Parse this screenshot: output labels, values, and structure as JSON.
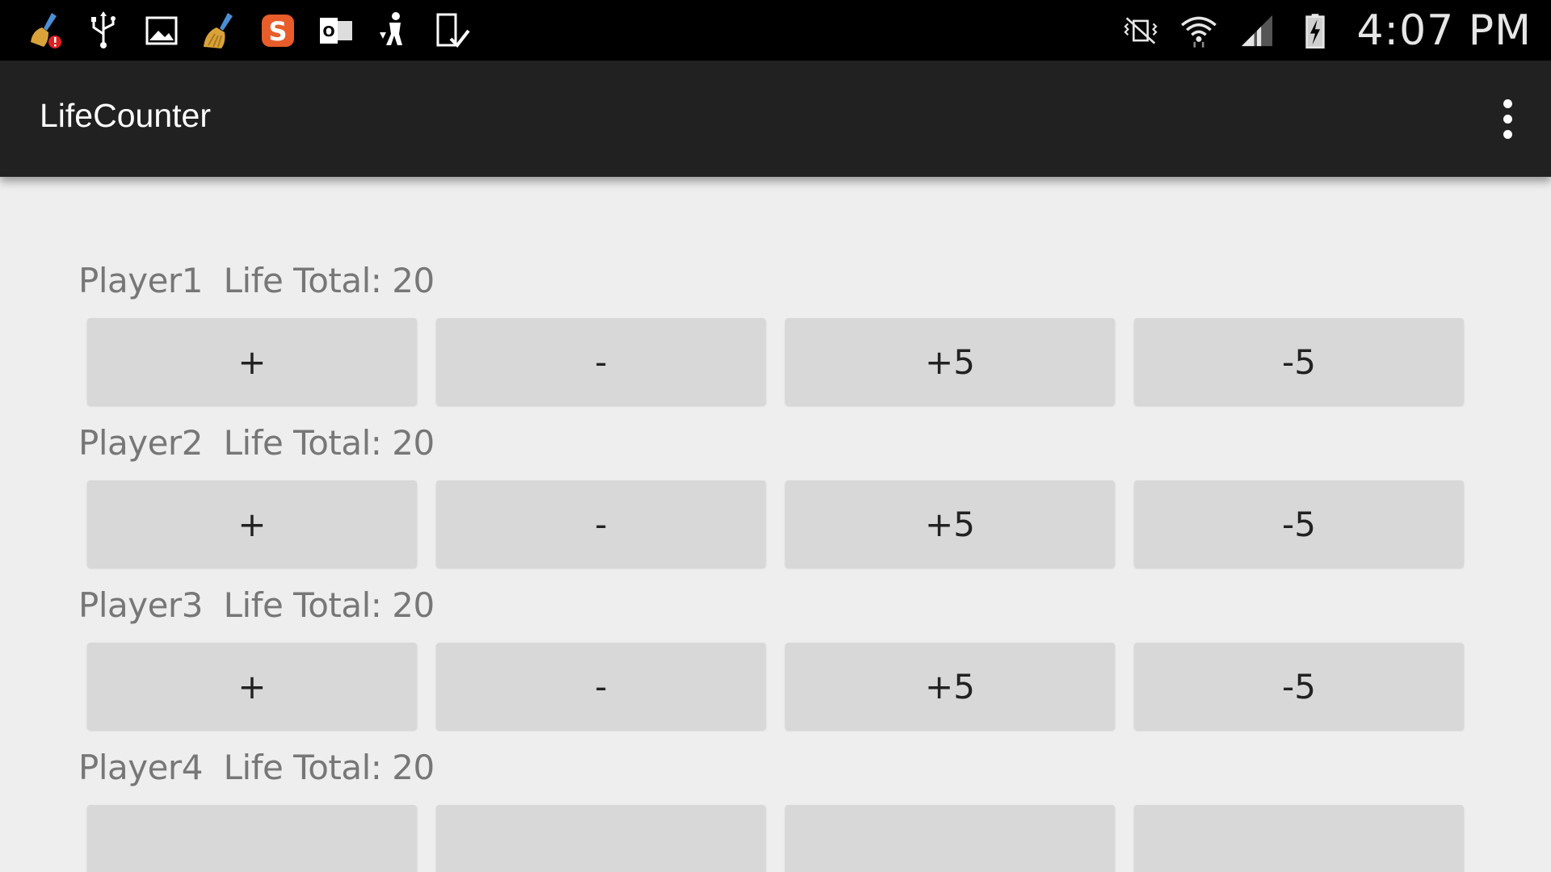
{
  "status_bar": {
    "notification_icons": [
      "clean-master-alert-icon",
      "usb-icon",
      "gallery-icon",
      "clean-master-icon",
      "swype-icon",
      "outlook-icon",
      "person-download-icon",
      "device-check-icon"
    ],
    "system_icons": [
      "vibrate-mute-icon",
      "wifi-icon",
      "signal-icon",
      "battery-charging-icon"
    ],
    "time": "4:07 PM"
  },
  "action_bar": {
    "title": "LifeCounter",
    "overflow_icon": "overflow-menu-icon"
  },
  "players": [
    {
      "name": "Player1",
      "life_label": "Life Total: 20",
      "buttons": [
        "+",
        "-",
        "+5",
        "-5"
      ]
    },
    {
      "name": "Player2",
      "life_label": "Life Total: 20",
      "buttons": [
        "+",
        "-",
        "+5",
        "-5"
      ]
    },
    {
      "name": "Player3",
      "life_label": "Life Total: 20",
      "buttons": [
        "+",
        "-",
        "+5",
        "-5"
      ]
    },
    {
      "name": "Player4",
      "life_label": "Life Total: 20",
      "buttons": [
        "",
        "",
        "",
        ""
      ]
    }
  ],
  "colors": {
    "status_bar_bg": "#000000",
    "action_bar_bg": "#212121",
    "content_bg": "#eeeeee",
    "button_bg": "#d8d8d8",
    "label_text": "#777777"
  }
}
